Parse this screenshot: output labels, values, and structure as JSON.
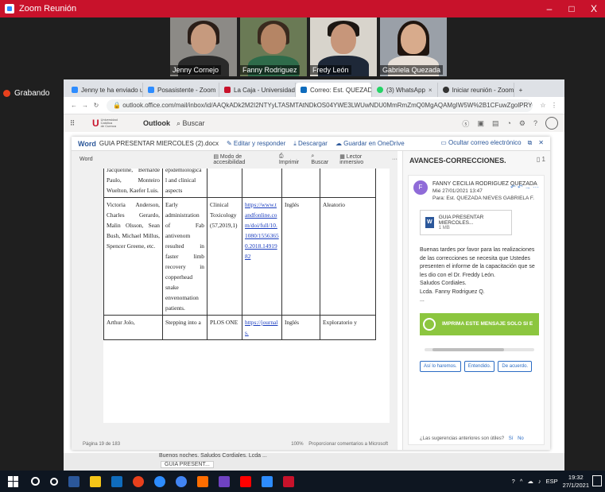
{
  "zoom": {
    "title": "Zoom Reunión",
    "recording_label": "Grabando",
    "window_controls": [
      "–",
      "□",
      "X"
    ],
    "participants": [
      {
        "name": "Jenny Cornejo"
      },
      {
        "name": "Fanny Rodriguez"
      },
      {
        "name": "Fredy León"
      },
      {
        "name": "Gabriela Quezada"
      }
    ]
  },
  "browser": {
    "tabs": [
      {
        "label": "Jenny te ha enviado un",
        "color": "#2d8cff"
      },
      {
        "label": "Posasistente - Zoom",
        "color": "#2d8cff"
      },
      {
        "label": "La Caja - Universidad C",
        "color": "#c8122b"
      },
      {
        "label": "Correo: Est. QUEZADA",
        "color": "#0f6cbd"
      },
      {
        "label": "(3) WhatsApp",
        "color": "#25d366"
      },
      {
        "label": "Iniciar reunión - Zoom",
        "color": "#333333"
      }
    ],
    "url": "outlook.office.com/mail/inbox/id/AAQkADk2M2I2NTYyLTASMTAtNDkOS04YWE3LWUwNDU0MmRmZmQ0MgAQAMgIW5W%2B1CFuwZgolPRYOf%3D/sxs/AAMkADk..."
  },
  "outlook": {
    "app_name": "Outlook",
    "search_placeholder": "Buscar"
  },
  "preview": {
    "app": "Word",
    "filename": "GUIA PRESENTAR MIERCOLES (2).docx",
    "edit_reply": "Editar y responder",
    "download": "Descargar",
    "save_onedrive": "Guardar en OneDrive",
    "hide_email": "Ocultar correo electrónico",
    "doc_label": "Word",
    "accessibility": "Modo de accesibilidad",
    "print": "Imprimir",
    "search": "Buscar",
    "immersive": "Lector inmersivo",
    "page_status": "Página 19 de 183",
    "zoom_level": "100%",
    "feedback": "Proporcionar comentarios a Microsoft"
  },
  "table_rows": [
    {
      "authors": "Jacqueline, Bernarde Paulo, Monteiro Wuelton, Kaefer Luis.",
      "title": "epidemiologica l and clinical aspects",
      "journal": "",
      "link": "",
      "language": "",
      "type": ""
    },
    {
      "authors": "Victoria Anderson, Charles Gerardo, Malin Olsson, Sean Bush, Michael Millus, Spencer Greene, etc.",
      "title": "Early administration of Fab antivenom resulted in faster limb recovery in copperhead snake envenomation patients.",
      "journal": "Clinical Toxicology (57,2019,1)",
      "link": "https://www.tandfonline.com/doi/full/10.1080/15563650.2018.1491982",
      "language": "Inglés",
      "type": "Aleatorio"
    },
    {
      "authors": "Arthur Jolo,",
      "title": "Stepping into a",
      "journal": "PLOS ONE",
      "link": "https://journals.",
      "language": "Inglés",
      "type": "Exploratorio y"
    }
  ],
  "reading_pane": {
    "subject": "AVANCES-CORRECCIONES.",
    "count": "1",
    "sender_name": "FANNY CECILIA RODRIGUEZ QUEZADA",
    "date": "Mié 27/01/2021 13:47",
    "to": "Para: Est. QUEZADA NIEVES GABRIELA F.",
    "avatar_letter": "F",
    "attachment_name": "GUIA PRESENTAR MIERCOLES...",
    "attachment_size": "1 MB",
    "body": [
      "Buenas tardes por favor para las realizaciones de las correcciones se necesita que Ustedes presenten el informe de la capacitación que se les dio con el Dr. Freddy León.",
      "Saludos Cordiales.",
      "Lcda. Fanny Rodriguez Q."
    ],
    "banner": "IMPRIMA ESTE MENSAJE SOLO SI E",
    "quick_replies": [
      "Así lo haremos.",
      "Entendido.",
      "De acuerdo."
    ],
    "suggestion_text": "¿Las sugerencias anteriores son útiles?",
    "yes": "Sí",
    "no": "No"
  },
  "owa_bottom": {
    "preview_line": "Buenos noches. Saludos Cordiales. Lcda ...",
    "attachment": "GUIA PRESENT..."
  },
  "taskbar": {
    "language": "ESP",
    "time": "19:32",
    "date": "27/1/2021",
    "icon_colors": [
      "#ffffff",
      "#f5c518",
      "#2b579a",
      "#0f6cbd",
      "#c8122b",
      "#2d8cff",
      "#f7a21b",
      "#4285f4",
      "#ff6d00",
      "#6f42c1",
      "#ff0000",
      "#2d8cff",
      "#c8122b"
    ]
  }
}
